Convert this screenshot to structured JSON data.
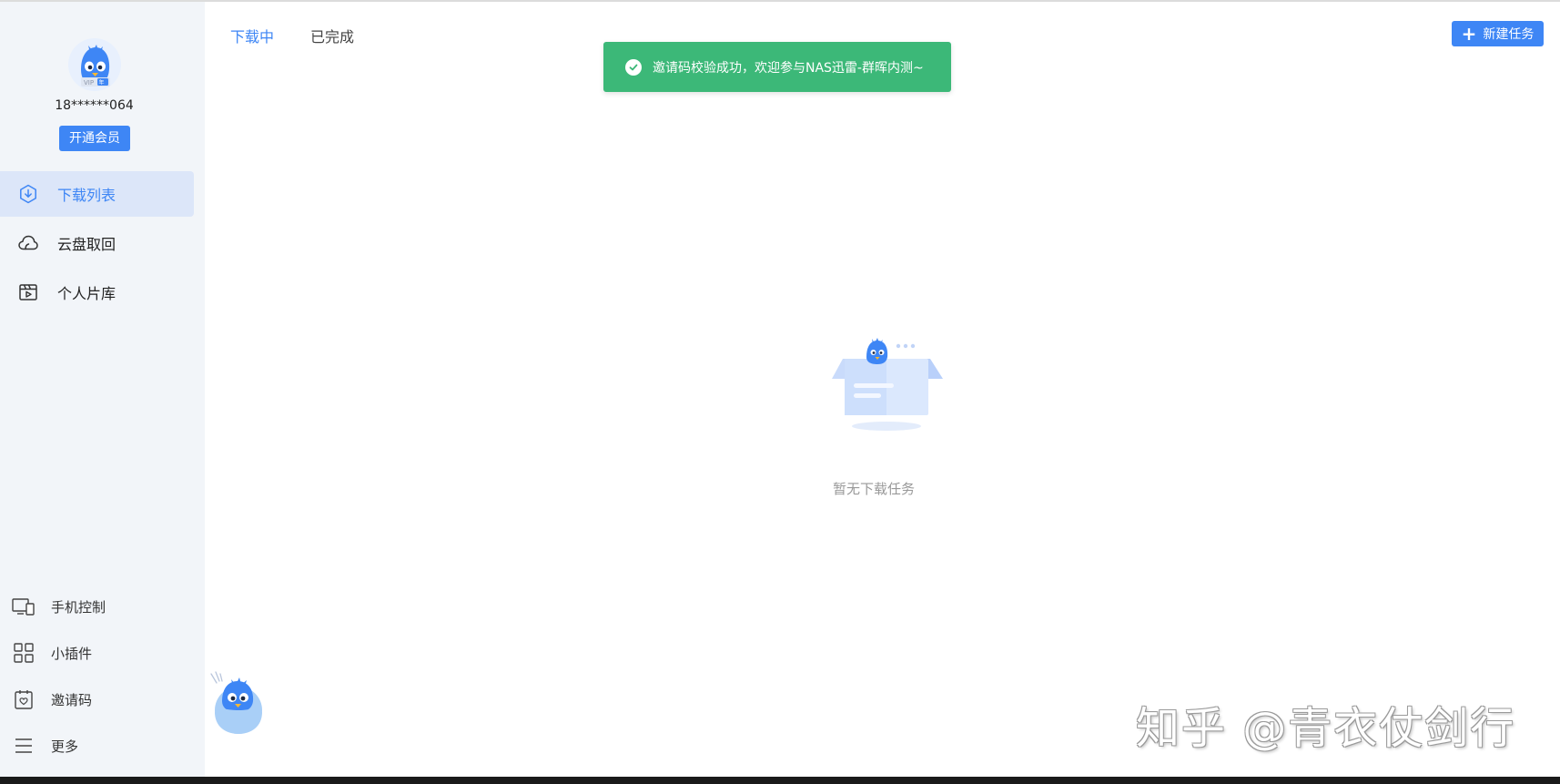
{
  "sidebar": {
    "user_phone": "18******064",
    "vip_button_label": "开通会员",
    "nav_items": [
      {
        "label": "下载列表",
        "icon": "download-circle-icon"
      },
      {
        "label": "云盘取回",
        "icon": "cloud-icon"
      },
      {
        "label": "个人片库",
        "icon": "video-library-icon"
      }
    ],
    "bottom_items": [
      {
        "label": "手机控制",
        "icon": "phone-control-icon"
      },
      {
        "label": "小插件",
        "icon": "grid-widgets-icon"
      },
      {
        "label": "邀请码",
        "icon": "invite-code-icon"
      },
      {
        "label": "更多",
        "icon": "menu-icon"
      }
    ]
  },
  "main": {
    "tabs": [
      {
        "label": "下载中"
      },
      {
        "label": "已完成"
      }
    ],
    "new_task_label": "新建任务",
    "toast_message": "邀请码校验成功，欢迎参与NAS迅雷-群晖内测~",
    "empty_text": "暂无下载任务"
  },
  "watermark": "知乎 @青衣仗剑行",
  "colors": {
    "accent": "#3e86f5",
    "toast_green": "#3cb878",
    "sidebar_bg": "#f2f5f9",
    "active_item_bg": "#dce6f9"
  }
}
